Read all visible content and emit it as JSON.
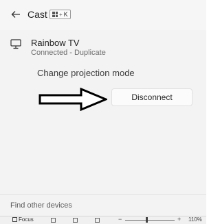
{
  "header": {
    "title": "Cast",
    "shortcut_key": "K",
    "shortcut_plus": "+"
  },
  "device": {
    "icon": "monitor-icon",
    "name": "Rainbow TV",
    "status": "Connected - Duplicate"
  },
  "actions": {
    "change_projection_label": "Change projection mode",
    "disconnect_label": "Disconnect"
  },
  "footer": {
    "find_devices_label": "Find other devices"
  },
  "taskbar": {
    "focus_label": "Focus",
    "zoom_minus": "−",
    "zoom_plus": "+",
    "zoom_level": "110%",
    "zoom_fraction": 0.42
  }
}
